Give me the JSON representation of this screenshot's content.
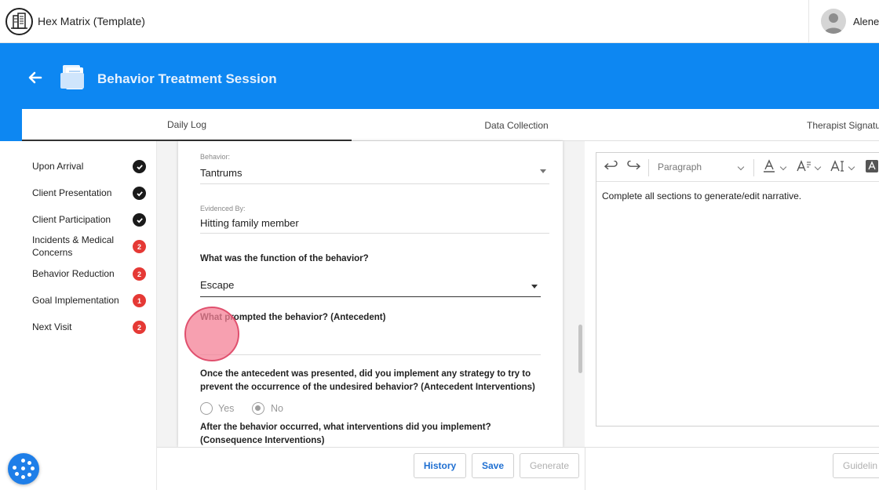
{
  "app": {
    "title": "Hex Matrix (Template)",
    "logo_icon": "building-icon"
  },
  "user": {
    "name": "Alene"
  },
  "header": {
    "title": "Behavior Treatment Session",
    "back_icon": "arrow-left-icon",
    "doc_icon": "document-icon",
    "color": "#0d87f2"
  },
  "tabs": [
    {
      "label": "Daily Log",
      "active": true
    },
    {
      "label": "Data Collection",
      "active": false
    },
    {
      "label": "Therapist Signatu",
      "active": false
    }
  ],
  "sidebar": {
    "items": [
      {
        "label": "Upon Arrival",
        "status": "complete"
      },
      {
        "label": "Client Presentation",
        "status": "complete"
      },
      {
        "label": "Client Participation",
        "status": "complete"
      },
      {
        "label": "Incidents & Medical Concerns",
        "status": "error",
        "count": "2"
      },
      {
        "label": "Behavior Reduction",
        "status": "error",
        "count": "2"
      },
      {
        "label": "Goal Implementation",
        "status": "error",
        "count": "1"
      },
      {
        "label": "Next Visit",
        "status": "error",
        "count": "2"
      }
    ]
  },
  "form": {
    "behavior": {
      "label": "Behavior:",
      "value": "Tantrums"
    },
    "evidenced": {
      "label": "Evidenced By:",
      "value": "Hitting family member"
    },
    "function": {
      "question": "What was the function of the behavior?",
      "value": "Escape"
    },
    "antecedent": {
      "question": "What prompted the behavior? (Antecedent)",
      "value": ""
    },
    "antecedent_interventions": {
      "question_line1": "Once the antecedent was presented, did you implement any strategy to try to",
      "question_line2": "prevent the occurrence of the undesired behavior? (Antecedent Interventions)",
      "options": [
        {
          "label": "Yes",
          "selected": false
        },
        {
          "label": "No",
          "selected": true
        }
      ]
    },
    "consequence": {
      "question_line1": "After the behavior occurred, what interventions did you implement?",
      "question_line2": "(Consequence Interventions)"
    }
  },
  "actions": {
    "history": "History",
    "save": "Save",
    "generate": "Generate",
    "guidelines": "Guidelin"
  },
  "editor": {
    "paragraph": "Paragraph",
    "narrative": "Complete all sections to generate/edit narrative.",
    "tools": [
      "undo-icon",
      "redo-icon",
      "font-color-icon",
      "font-size-icon",
      "text-case-icon",
      "text-style-icon"
    ]
  },
  "colors": {
    "accent": "#0d87f2",
    "error": "#e53935",
    "complete": "#1a1a1a",
    "link": "#1f6fd1"
  }
}
